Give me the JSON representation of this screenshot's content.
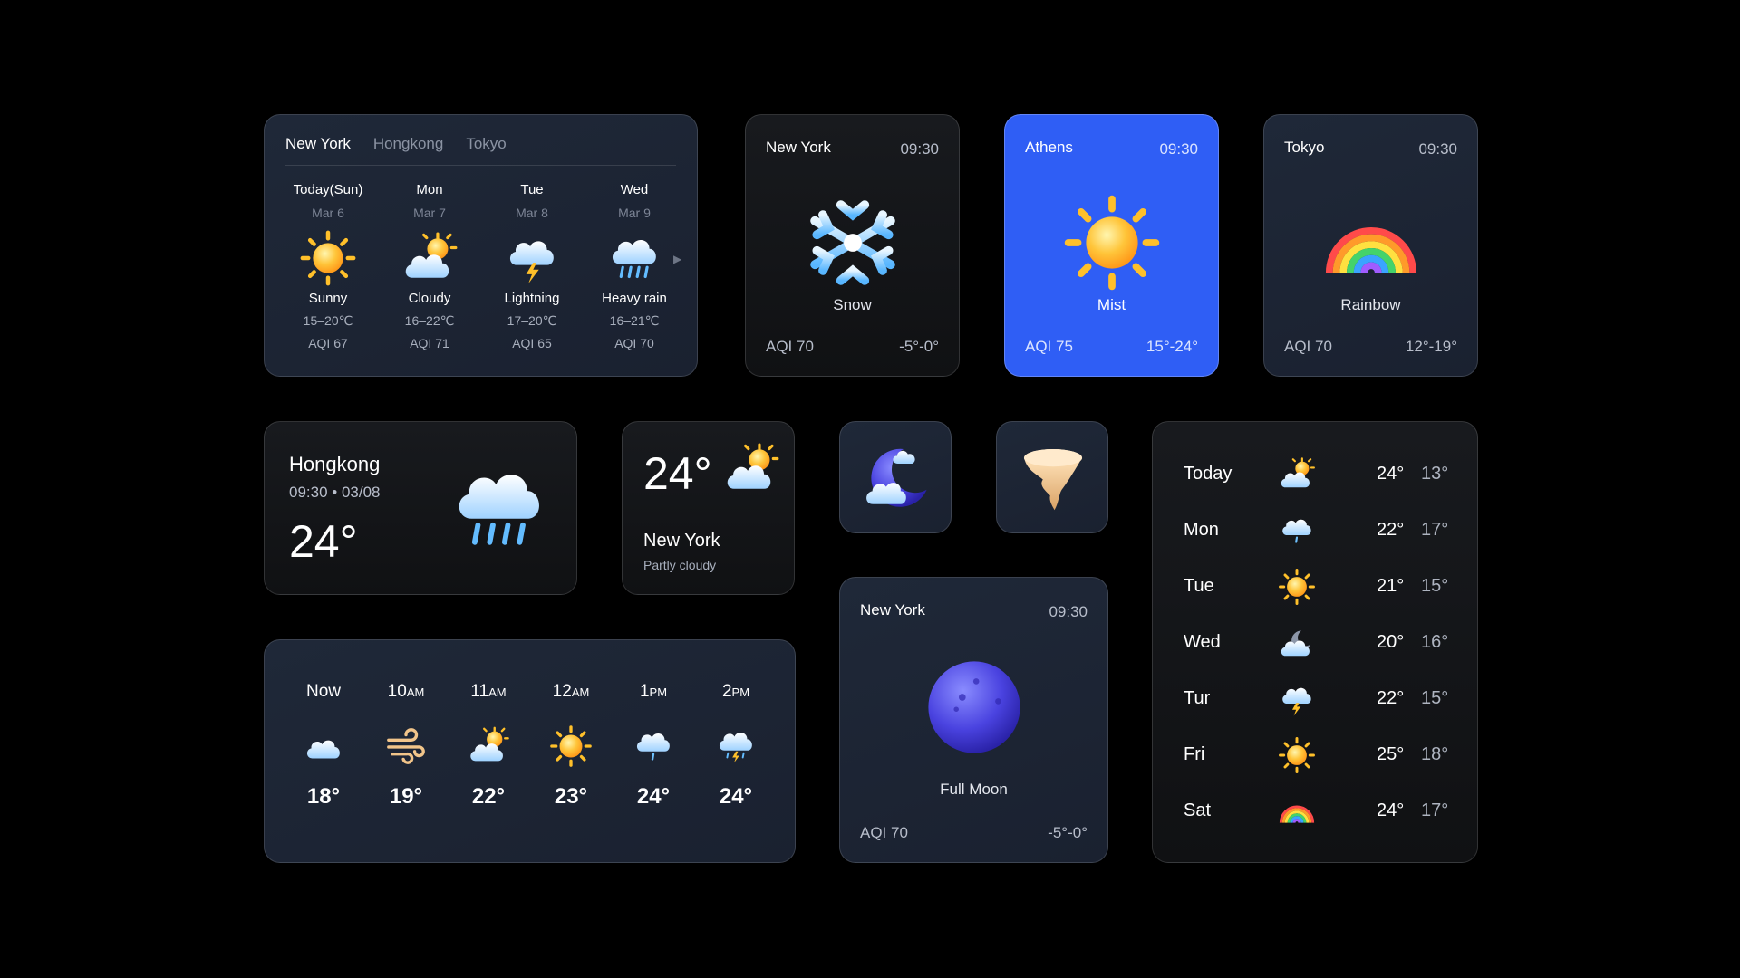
{
  "forecast_card": {
    "tabs": [
      "New York",
      "Hongkong",
      "Tokyo"
    ],
    "active_tab": "New York",
    "days": [
      {
        "day": "Today(Sun)",
        "date": "Mar 6",
        "icon": "sunny-icon",
        "condition": "Sunny",
        "range": "15–20℃",
        "aqi": "AQI 67"
      },
      {
        "day": "Mon",
        "date": "Mar 7",
        "icon": "partly-cloudy-icon",
        "condition": "Cloudy",
        "range": "16–22℃",
        "aqi": "AQI 71"
      },
      {
        "day": "Tue",
        "date": "Mar 8",
        "icon": "lightning-icon",
        "condition": "Lightning",
        "range": "17–20℃",
        "aqi": "AQI 65"
      },
      {
        "day": "Wed",
        "date": "Mar 9",
        "icon": "heavy-rain-icon",
        "condition": "Heavy rain",
        "range": "16–21℃",
        "aqi": "AQI 70"
      }
    ]
  },
  "city_cards": [
    {
      "city": "New York",
      "time": "09:30",
      "icon": "snowflake-icon",
      "condition": "Snow",
      "aqi": "AQI 70",
      "range": "-5°-0°"
    },
    {
      "city": "Athens",
      "time": "09:30",
      "icon": "sun-icon",
      "condition": "Mist",
      "aqi": "AQI 75",
      "range": "15°-24°"
    },
    {
      "city": "Tokyo",
      "time": "09:30",
      "icon": "rainbow-icon",
      "condition": "Rainbow",
      "aqi": "AQI 70",
      "range": "12°-19°"
    }
  ],
  "hongkong_card": {
    "city": "Hongkong",
    "subtitle": "09:30 • 03/08",
    "temp": "24°",
    "icon": "rain-cloud-icon"
  },
  "partly_cloudy_card": {
    "temp": "24°",
    "city": "New York",
    "condition": "Partly cloudy",
    "icon": "partly-cloudy-icon"
  },
  "icon_tiles": [
    {
      "icon": "crescent-moon-cloud-icon"
    },
    {
      "icon": "tornado-icon"
    }
  ],
  "hourly": [
    {
      "label": "Now",
      "suffix": "",
      "icon": "cloud-icon",
      "temp": "18°"
    },
    {
      "label": "10",
      "suffix": "AM",
      "icon": "wind-icon",
      "temp": "19°"
    },
    {
      "label": "11",
      "suffix": "AM",
      "icon": "partly-cloudy-icon",
      "temp": "22°"
    },
    {
      "label": "12",
      "suffix": "AM",
      "icon": "sun-icon",
      "temp": "23°"
    },
    {
      "label": "1",
      "suffix": "PM",
      "icon": "rain-icon",
      "temp": "24°"
    },
    {
      "label": "2",
      "suffix": "PM",
      "icon": "thunder-rain-icon",
      "temp": "24°"
    }
  ],
  "full_moon_card": {
    "city": "New York",
    "time": "09:30",
    "icon": "full-moon-icon",
    "condition": "Full Moon",
    "aqi": "AQI 70",
    "range": "-5°-0°"
  },
  "weekly": [
    {
      "day": "Today",
      "icon": "partly-cloudy-icon",
      "high": "24°",
      "low": "13°"
    },
    {
      "day": "Mon",
      "icon": "rain-icon",
      "high": "22°",
      "low": "17°"
    },
    {
      "day": "Tue",
      "icon": "sun-icon",
      "high": "21°",
      "low": "15°"
    },
    {
      "day": "Wed",
      "icon": "cloudy-night-icon",
      "high": "20°",
      "low": "16°"
    },
    {
      "day": "Tur",
      "icon": "thunder-icon",
      "high": "22°",
      "low": "15°"
    },
    {
      "day": "Fri",
      "icon": "sun-icon",
      "high": "25°",
      "low": "18°"
    },
    {
      "day": "Sat",
      "icon": "rainbow-icon",
      "high": "24°",
      "low": "17°"
    }
  ],
  "colors": {
    "card_navy": "#1f2838",
    "card_dark": "#141518",
    "accent_blue": "#2f5ef5",
    "sun": "#ffb020",
    "cloud": "#bfe3ff"
  }
}
